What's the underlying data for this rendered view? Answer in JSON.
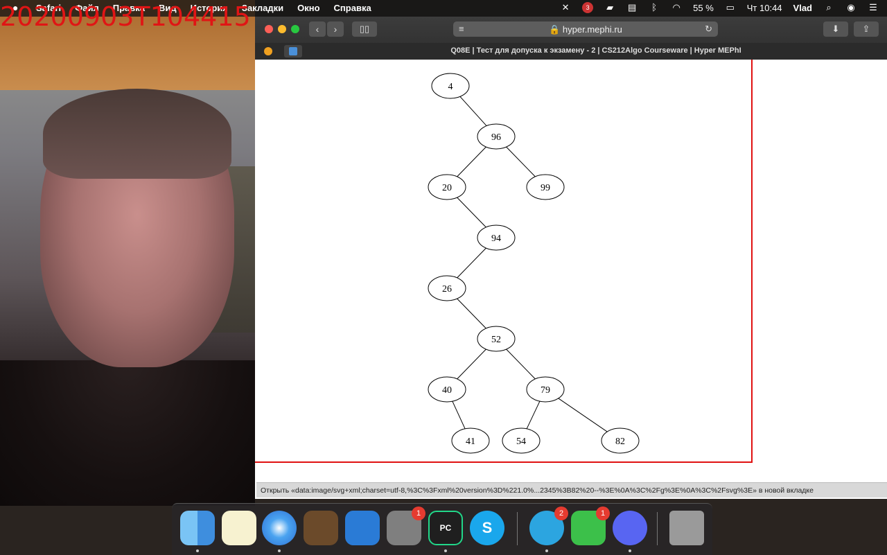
{
  "webcam": {
    "timestamp": "20200903T104415"
  },
  "menubar": {
    "apple_icon": "apple-icon",
    "menus": [
      "Safari",
      "Файл",
      "Правка",
      "Вид",
      "История",
      "Закладки",
      "Окно",
      "Справка"
    ],
    "battery": "55 %",
    "clock": "Чт 10:44",
    "user": "Vlad",
    "notification_badge": "3"
  },
  "browser": {
    "url": "hyper.mephi.ru",
    "tab_title": "Q08E | Тест для допуска к экзамену - 2 | CS212Algo Courseware | Hyper MEPhI",
    "status_text": "Открыть «data:image/svg+xml;charset=utf-8,%3C%3Fxml%20version%3D%221.0%...2345%3B82%20--%3E%0A%3C%2Fg%3E%0A%3C%2Fsvg%3E» в новой вкладке"
  },
  "tree": {
    "nodes": [
      "4",
      "96",
      "20",
      "99",
      "94",
      "26",
      "52",
      "40",
      "79",
      "41",
      "54",
      "82"
    ],
    "edges": [
      [
        "4",
        "96"
      ],
      [
        "96",
        "20"
      ],
      [
        "96",
        "99"
      ],
      [
        "20",
        "94"
      ],
      [
        "94",
        "26"
      ],
      [
        "26",
        "52"
      ],
      [
        "52",
        "40"
      ],
      [
        "52",
        "79"
      ],
      [
        "40",
        "41"
      ],
      [
        "79",
        "54"
      ],
      [
        "79",
        "82"
      ]
    ]
  },
  "dock": {
    "apps": [
      {
        "name": "Finder",
        "label": "",
        "badge": ""
      },
      {
        "name": "Notes",
        "label": "",
        "badge": ""
      },
      {
        "name": "Safari",
        "label": "",
        "badge": ""
      },
      {
        "name": "GarageBand",
        "label": "",
        "badge": ""
      },
      {
        "name": "Xcode",
        "label": "",
        "badge": ""
      },
      {
        "name": "System Preferences",
        "label": "",
        "badge": "1"
      },
      {
        "name": "PyCharm",
        "label": "PC",
        "badge": ""
      },
      {
        "name": "Skype",
        "label": "S",
        "badge": ""
      },
      {
        "name": "Telegram",
        "label": "",
        "badge": "2"
      },
      {
        "name": "FaceTime",
        "label": "",
        "badge": "1"
      },
      {
        "name": "Discord",
        "label": "",
        "badge": ""
      },
      {
        "name": "Trash",
        "label": "",
        "badge": ""
      }
    ]
  }
}
